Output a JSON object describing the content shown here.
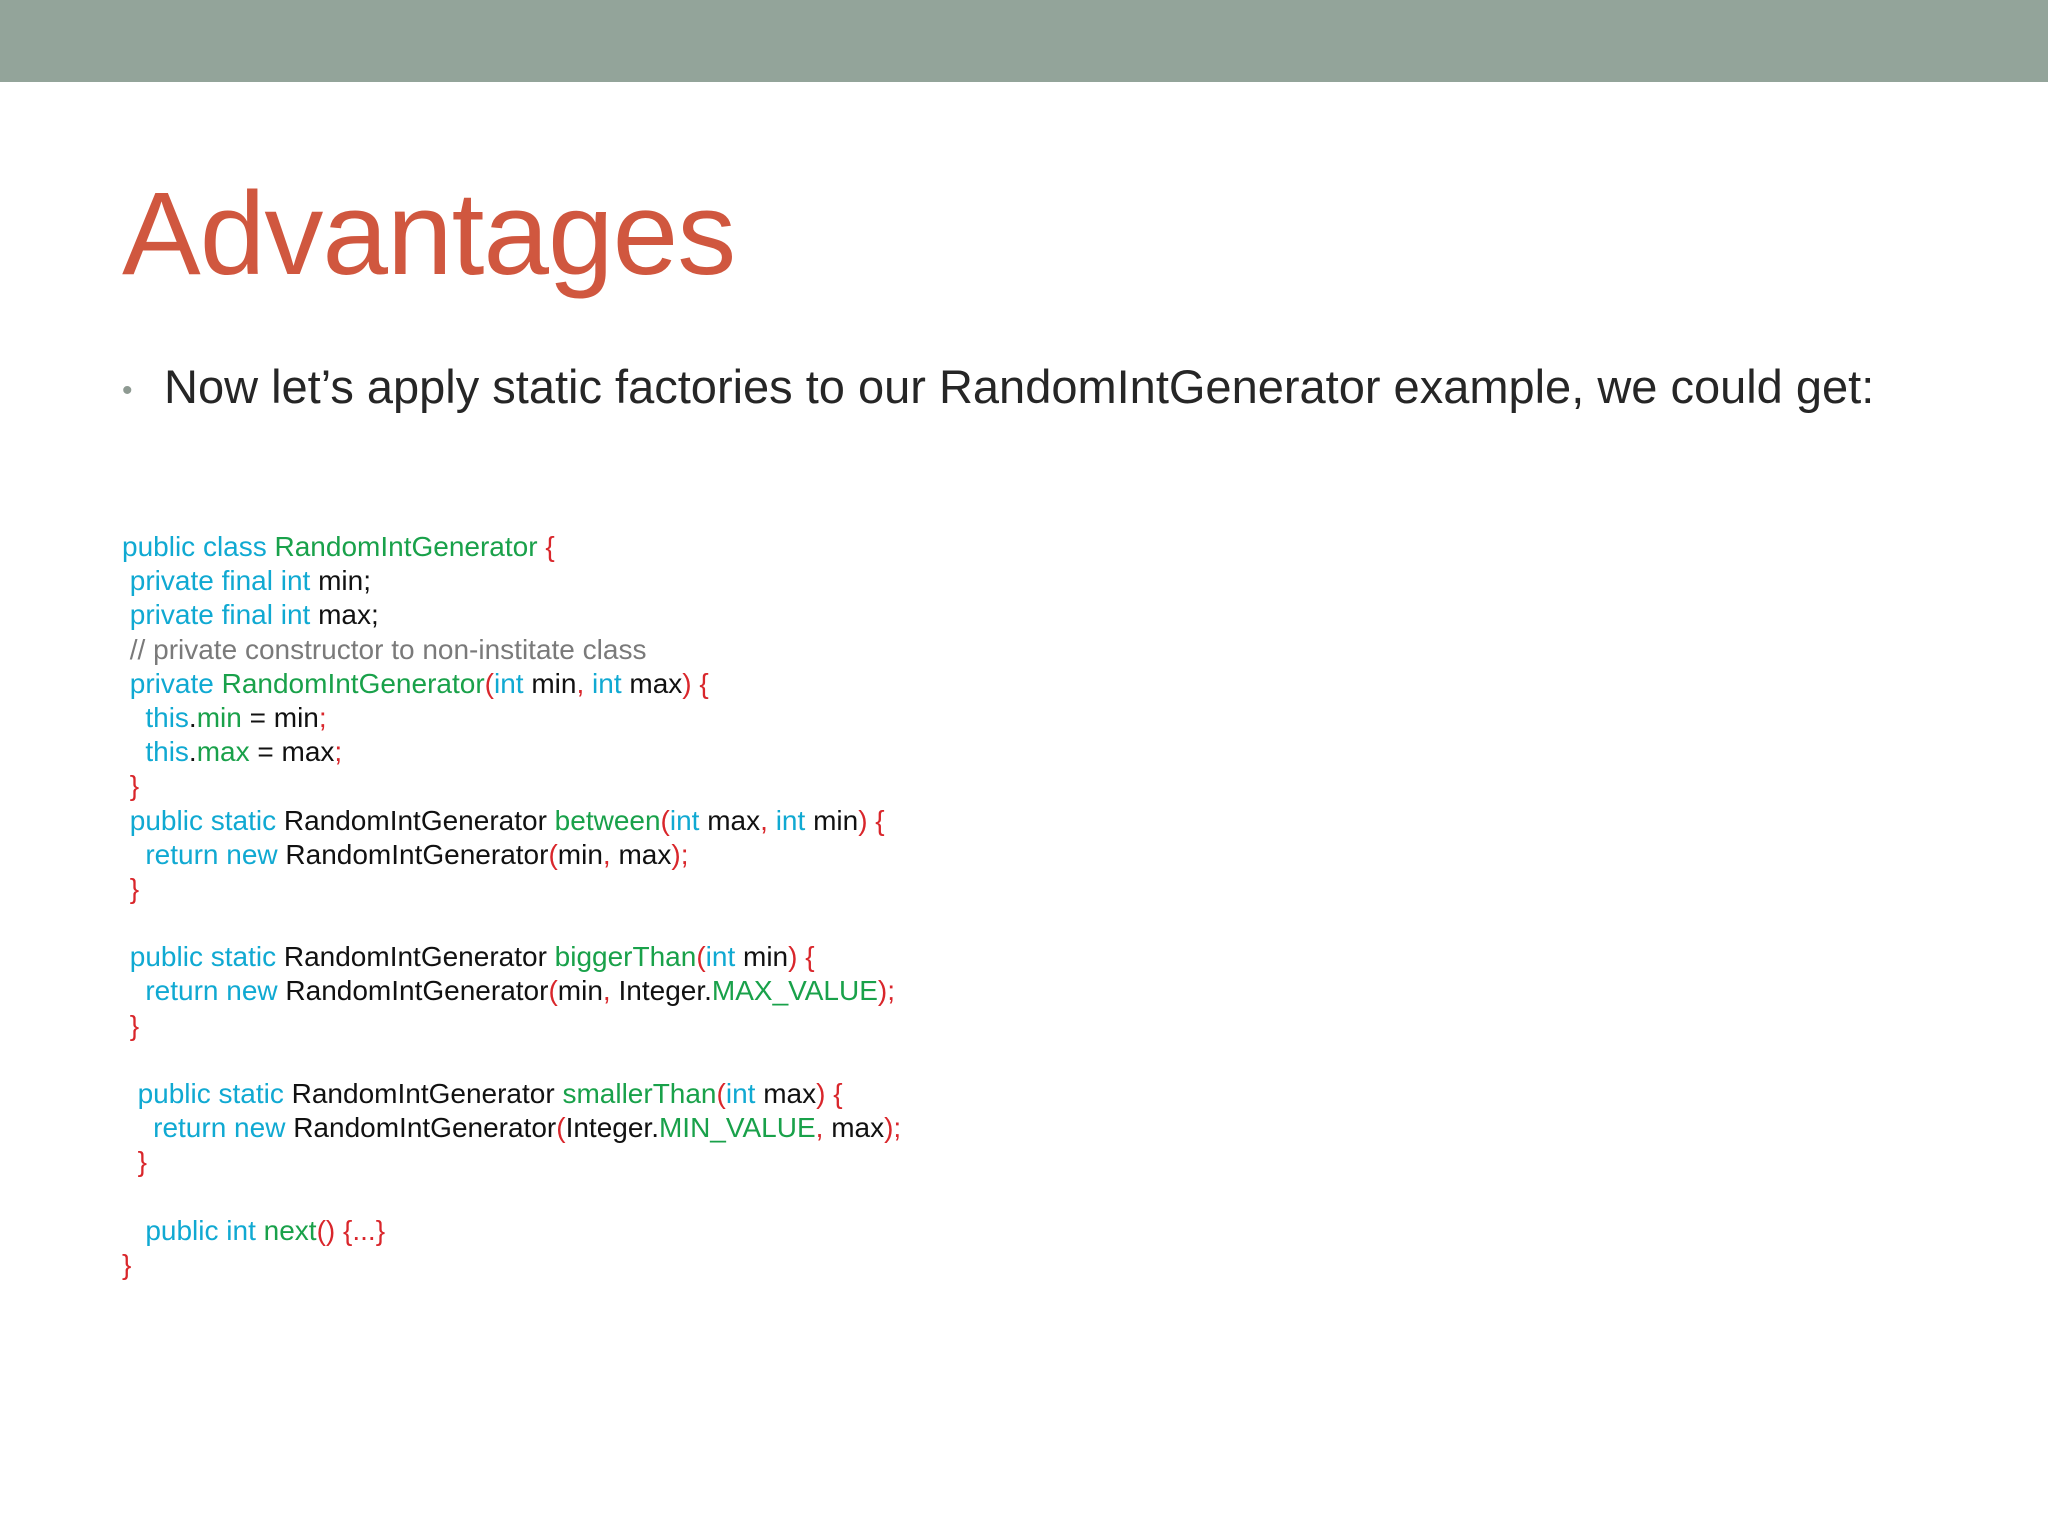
{
  "slide": {
    "title": "Advantages",
    "bullet": "Now let’s apply static factories to our RandomIntGenerator example, we could get:",
    "colors": {
      "top_band": "#93a49a",
      "title": "#d0573f",
      "keyword": "#10a9d2",
      "identifier_green": "#19a14a",
      "punctuation_red": "#d9262b",
      "comment_gray": "#7a7a7a",
      "plain": "#111111"
    }
  },
  "code_lines": [
    [
      [
        "kw",
        "public class "
      ],
      [
        "fn",
        "RandomIntGenerator "
      ],
      [
        "pu",
        "{"
      ]
    ],
    [
      [
        "pl",
        " "
      ],
      [
        "kw",
        "private final int "
      ],
      [
        "pl",
        "min;"
      ]
    ],
    [
      [
        "pl",
        " "
      ],
      [
        "kw",
        "private final int "
      ],
      [
        "pl",
        "max;"
      ]
    ],
    [
      [
        "cm",
        " // private constructor to non-institate class"
      ]
    ],
    [
      [
        "pl",
        " "
      ],
      [
        "kw",
        "private "
      ],
      [
        "fn",
        "RandomIntGenerator"
      ],
      [
        "pu",
        "("
      ],
      [
        "kw",
        "int "
      ],
      [
        "pl",
        "min"
      ],
      [
        "pu",
        ", "
      ],
      [
        "kw",
        "int "
      ],
      [
        "pl",
        "max"
      ],
      [
        "pu",
        ") {"
      ]
    ],
    [
      [
        "pl",
        "   "
      ],
      [
        "kw",
        "this"
      ],
      [
        "pl",
        "."
      ],
      [
        "fn",
        "min"
      ],
      [
        "pl",
        " = min"
      ],
      [
        "pu",
        ";"
      ]
    ],
    [
      [
        "pl",
        "   "
      ],
      [
        "kw",
        "this"
      ],
      [
        "pl",
        "."
      ],
      [
        "fn",
        "max"
      ],
      [
        "pl",
        " = max"
      ],
      [
        "pu",
        ";"
      ]
    ],
    [
      [
        "pl",
        " "
      ],
      [
        "pu",
        "}"
      ]
    ],
    [
      [
        "pl",
        " "
      ],
      [
        "kw",
        "public static "
      ],
      [
        "pl",
        "RandomIntGenerator "
      ],
      [
        "fn",
        "between"
      ],
      [
        "pu",
        "("
      ],
      [
        "kw",
        "int "
      ],
      [
        "pl",
        "max"
      ],
      [
        "pu",
        ", "
      ],
      [
        "kw",
        "int "
      ],
      [
        "pl",
        "min"
      ],
      [
        "pu",
        ") {"
      ]
    ],
    [
      [
        "pl",
        "   "
      ],
      [
        "kw",
        "return new "
      ],
      [
        "pl",
        "RandomIntGenerator"
      ],
      [
        "pu",
        "("
      ],
      [
        "pl",
        "min"
      ],
      [
        "pu",
        ", "
      ],
      [
        "pl",
        "max"
      ],
      [
        "pu",
        ");"
      ]
    ],
    [
      [
        "pl",
        " "
      ],
      [
        "pu",
        "}"
      ]
    ],
    [],
    [
      [
        "pl",
        " "
      ],
      [
        "kw",
        "public static "
      ],
      [
        "pl",
        "RandomIntGenerator "
      ],
      [
        "fn",
        "biggerThan"
      ],
      [
        "pu",
        "("
      ],
      [
        "kw",
        "int "
      ],
      [
        "pl",
        "min"
      ],
      [
        "pu",
        ") {"
      ]
    ],
    [
      [
        "pl",
        "   "
      ],
      [
        "kw",
        "return new "
      ],
      [
        "pl",
        "RandomIntGenerator"
      ],
      [
        "pu",
        "("
      ],
      [
        "pl",
        "min"
      ],
      [
        "pu",
        ", "
      ],
      [
        "pl",
        "Integer."
      ],
      [
        "fn",
        "MAX_VALUE"
      ],
      [
        "pu",
        ");"
      ]
    ],
    [
      [
        "pl",
        " "
      ],
      [
        "pu",
        "}"
      ]
    ],
    [],
    [
      [
        "pl",
        "  "
      ],
      [
        "kw",
        "public static "
      ],
      [
        "pl",
        "RandomIntGenerator "
      ],
      [
        "fn",
        "smallerThan"
      ],
      [
        "pu",
        "("
      ],
      [
        "kw",
        "int "
      ],
      [
        "pl",
        "max"
      ],
      [
        "pu",
        ") {"
      ]
    ],
    [
      [
        "pl",
        "    "
      ],
      [
        "kw",
        "return new "
      ],
      [
        "pl",
        "RandomIntGenerator"
      ],
      [
        "pu",
        "("
      ],
      [
        "pl",
        "Integer."
      ],
      [
        "fn",
        "MIN_VALUE"
      ],
      [
        "pu",
        ", "
      ],
      [
        "pl",
        "max"
      ],
      [
        "pu",
        ");"
      ]
    ],
    [
      [
        "pl",
        "  "
      ],
      [
        "pu",
        "}"
      ]
    ],
    [],
    [
      [
        "pl",
        "   "
      ],
      [
        "kw",
        "public int "
      ],
      [
        "fn",
        "next"
      ],
      [
        "pu",
        "() {...}"
      ]
    ],
    [
      [
        "pu",
        "}"
      ]
    ]
  ]
}
